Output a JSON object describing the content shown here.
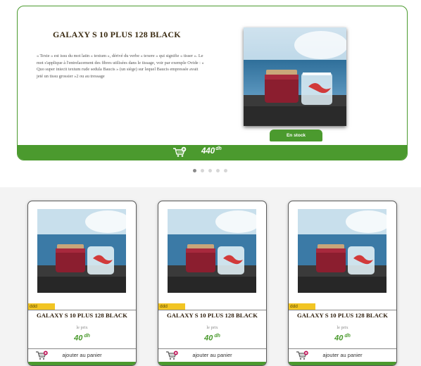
{
  "hero": {
    "title": "GALAXY S 10 PLUS 128 BLACK",
    "description": "« Texte » est issu du mot latin « textum », dérivé du verbe « texere » qui signifie « tisser ». Le mot s'applique à l'entrelacement des fibres utilisées dans le tissage, voir par exemple Ovide : « Quo super iniecit textum rude sedula Baucis » (un siège) sur lequel Baucis empressée avait jeté un tissu grossier »2 ou au tressage",
    "stock_label": "En stock",
    "price": "440",
    "currency": "dh",
    "slides": 5,
    "active_slide": 0
  },
  "products": [
    {
      "tag": "ddd",
      "name": "GALAXY S 10 PLUS 128 BLACK",
      "price_label": "le prix",
      "price": "40",
      "currency": "dh",
      "add_label": "ajouter au panier"
    },
    {
      "tag": "ddd",
      "name": "GALAXY S 10 PLUS 128 BLACK",
      "price_label": "le prix",
      "price": "40",
      "currency": "dh",
      "add_label": "ajouter au panier"
    },
    {
      "tag": "ddd",
      "name": "GALAXY S 10 PLUS 128 BLACK",
      "price_label": "le prix",
      "price": "40",
      "currency": "dh",
      "add_label": "ajouter au panier"
    }
  ],
  "colors": {
    "accent_green": "#4b9a2e",
    "tag_yellow": "#f2c523",
    "cart_badge": "#c2185b"
  },
  "icons": {
    "cart": "cart-plus-icon"
  }
}
